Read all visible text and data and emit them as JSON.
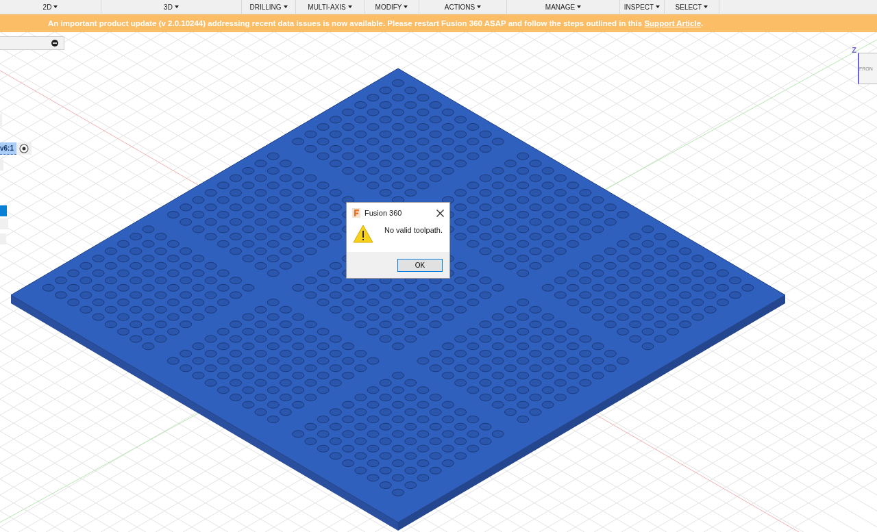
{
  "toolbar": {
    "menus": [
      {
        "label": "2D"
      },
      {
        "label": "3D"
      },
      {
        "label": "DRILLING"
      },
      {
        "label": "MULTI-AXIS"
      },
      {
        "label": "MODIFY"
      },
      {
        "label": "ACTIONS"
      },
      {
        "label": "MANAGE"
      },
      {
        "label": "INSPECT"
      },
      {
        "label": "SELECT"
      }
    ]
  },
  "banner": {
    "text": "An important product update (v 2.0.10244) addressing recent data issues is now available. Please restart Fusion 360 ASAP and follow the steps outlined in this ",
    "link": "Support Article",
    "end": "."
  },
  "browser": {
    "item_label": "v6:1"
  },
  "view_cube": {
    "axis": "Z",
    "face": "FRON"
  },
  "dialog": {
    "title": "Fusion 360",
    "message": "No valid toolpath.",
    "button": "OK"
  }
}
